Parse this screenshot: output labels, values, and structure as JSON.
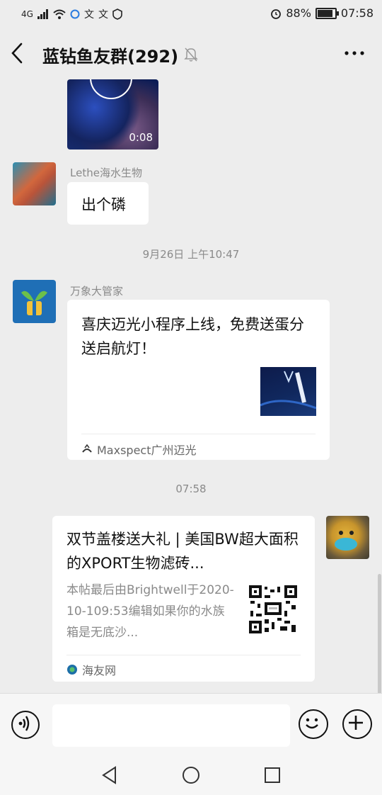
{
  "status": {
    "network": "4G",
    "battery": "88%",
    "battery_fraction": 0.88,
    "time": "07:58"
  },
  "header": {
    "title": "蓝钻鱼友群(292)"
  },
  "messages": {
    "video": {
      "duration": "0:08"
    },
    "m1": {
      "sender": "Lethe海水生物",
      "text": "出个磷"
    },
    "ts1": "9月26日 上午10:47",
    "m2": {
      "sender": "万象大管家",
      "card_title": "喜庆迈光小程序上线，免费送蛋分送启航灯！",
      "source": "Maxspect广州迈光"
    },
    "ts2": "07:58",
    "m3": {
      "card_title": "双节盖楼送大礼 | 美国BW超大面积的XPORT生物滤砖...",
      "card_desc": "本帖最后由Brightwell于2020-10-109:53编辑如果你的水族箱是无底沙...",
      "source": "海友网"
    }
  },
  "input": {
    "placeholder": ""
  },
  "colors": {
    "background": "#ededed",
    "bubble": "#ffffff",
    "meta_text": "#8a8a8a"
  }
}
